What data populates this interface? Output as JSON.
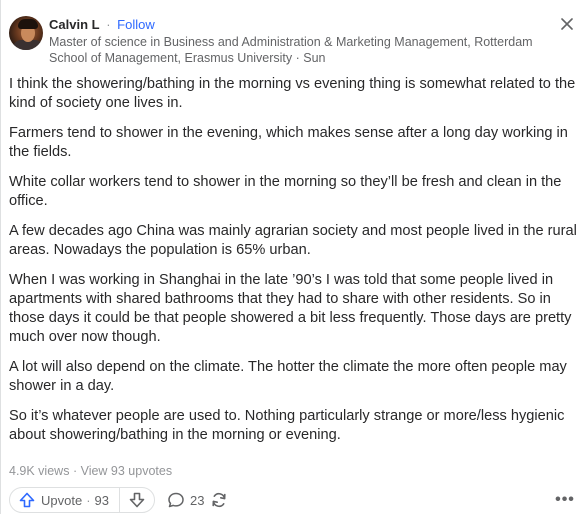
{
  "author": {
    "name": "Calvin L",
    "follow_label": "Follow",
    "separator": "·",
    "credential": "Master of science in Business and Administration & Marketing Management, Rotterdam School of Management, Erasmus University · Sun"
  },
  "post": {
    "paragraphs": [
      "I think the showering/bathing in the morning vs evening thing is somewhat related to the kind of society one lives in.",
      "Farmers tend to shower in the evening, which makes sense after a long day working in the fields.",
      "White collar workers tend to shower in the morning so they’ll be fresh and clean in the office.",
      "A few decades ago China was mainly agrarian society and most people lived in the rural areas. Nowadays the population is 65% urban.",
      "When I was working in Shanghai in the late ’90’s I was told that some people lived in apartments with shared bathrooms that they had to share with other residents. So in those days it could be that people showered a bit less frequently. Those days are pretty much over now though.",
      "A lot will also depend on the climate. The hotter the climate the more often people may shower in a day.",
      "So it’s whatever people are used to. Nothing particularly strange or more/less hygienic about showering/bathing in the morning or evening."
    ]
  },
  "stats": {
    "views": "4.9K views",
    "separator": "·",
    "upvotes_link": "View 93 upvotes"
  },
  "actions": {
    "upvote_label": "Upvote",
    "upvote_separator": "·",
    "upvote_count": "93",
    "comment_count": "23",
    "more_label": "•••"
  },
  "icons": {
    "close": "close-icon",
    "upvote": "upvote-arrow-icon",
    "downvote": "downvote-arrow-icon",
    "comment": "comment-bubble-icon",
    "share": "share-icon",
    "more": "more-options-icon"
  },
  "colors": {
    "accent": "#2e69ff",
    "text": "#282829",
    "muted": "#636466",
    "border": "#dee0e1"
  }
}
